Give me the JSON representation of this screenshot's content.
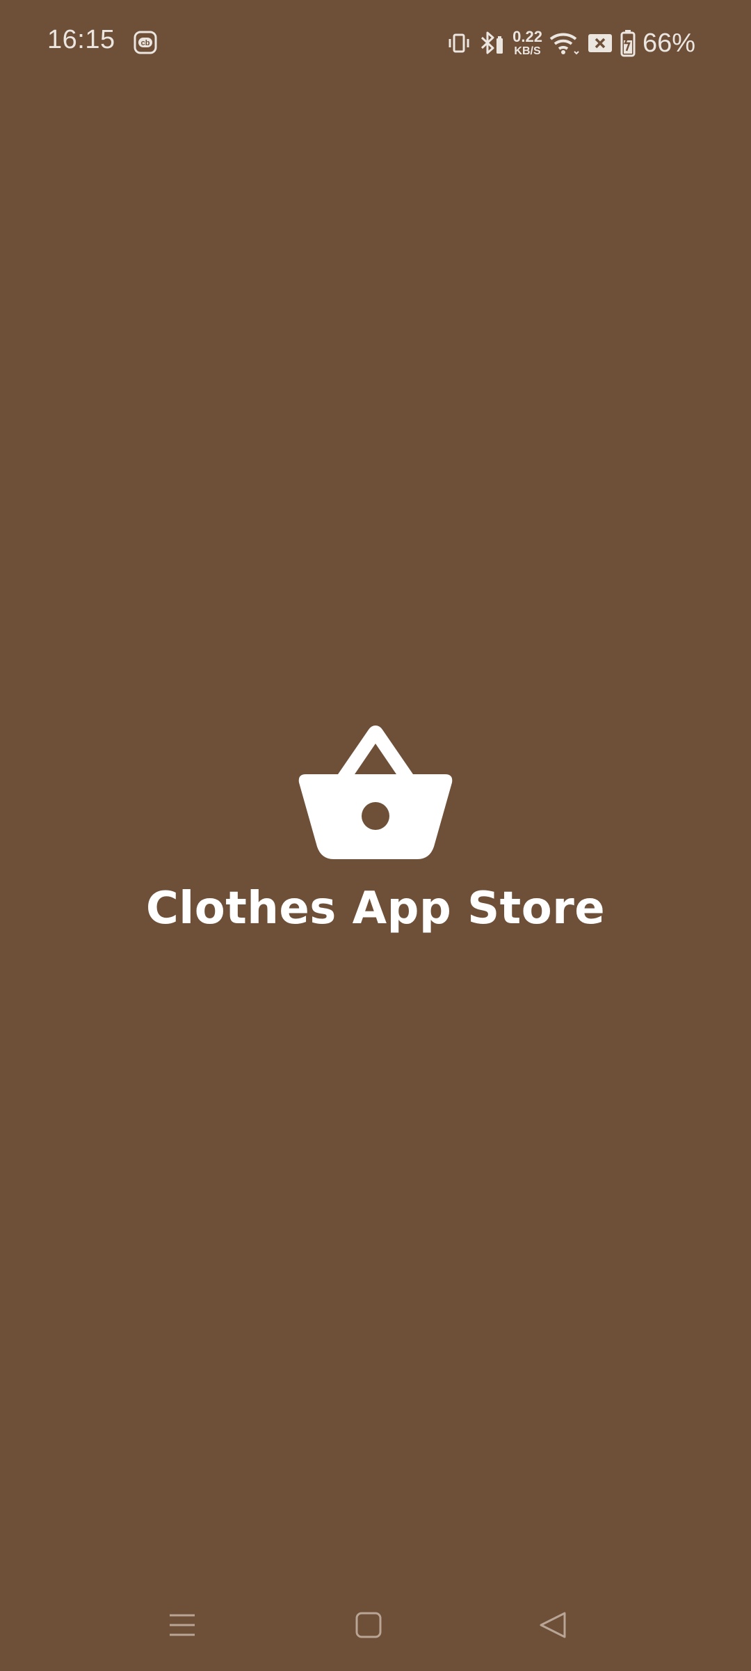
{
  "status_bar": {
    "time": "16:15",
    "app_notification_icon": "cb-icon",
    "icons": [
      "vibrate-icon",
      "bluetooth-icon",
      "wifi-icon",
      "sim-off-icon",
      "battery-charging-icon"
    ],
    "net_speed_value": "0.22",
    "net_speed_unit": "KB/S",
    "battery_percent": "66%"
  },
  "splash": {
    "logo_icon": "shopping-basket-icon",
    "title": "Clothes App Store"
  },
  "nav_bar": {
    "buttons": [
      "menu-icon",
      "home-icon",
      "back-icon"
    ]
  },
  "colors": {
    "background": "#6e4f38",
    "foreground": "#ffffff"
  }
}
